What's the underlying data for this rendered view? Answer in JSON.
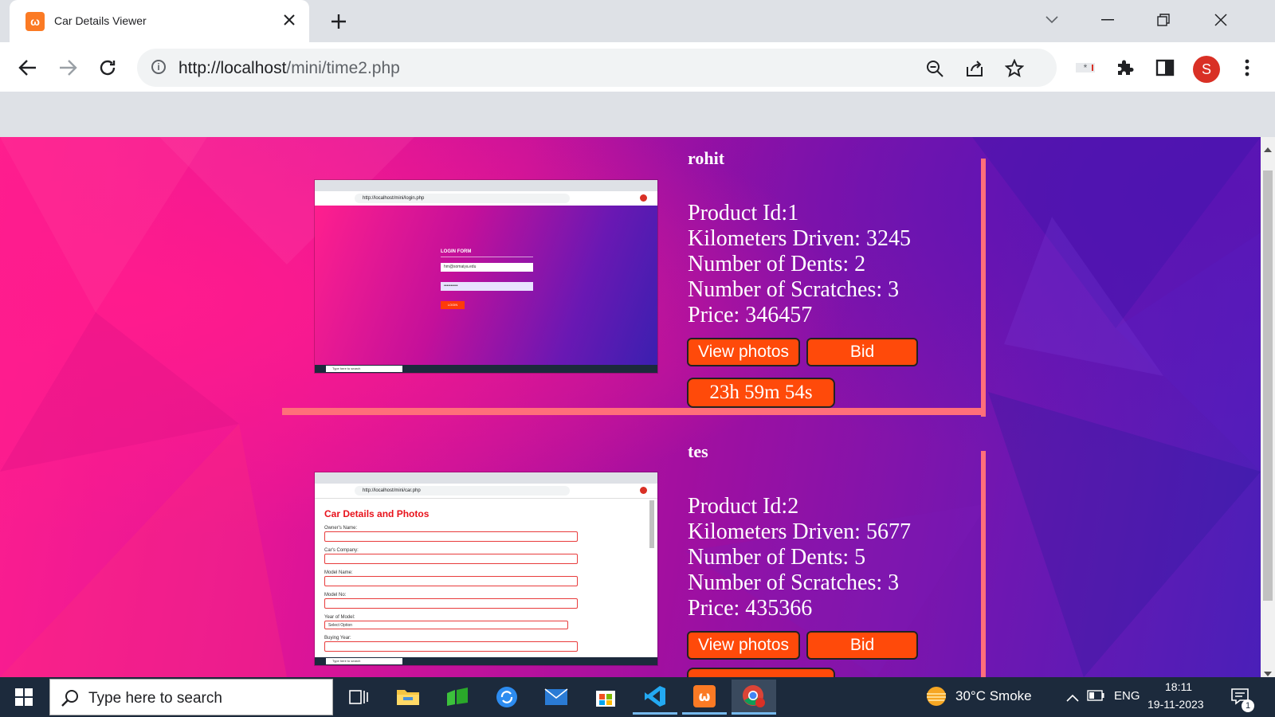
{
  "browser": {
    "tab_title": "Car Details Viewer",
    "url_host": "http://localhost",
    "url_path": "/mini/time2.php",
    "profile_initial": "S",
    "extension_badge": "*"
  },
  "listings": [
    {
      "owner": "rohit",
      "product_id": "Product Id:1",
      "kilometers": "Kilometers Driven: 3245",
      "dents": "Number of Dents: 2",
      "scratches": "Number of Scratches: 3",
      "price": "Price: 346457",
      "view_label": "View photos",
      "bid_label": "Bid",
      "timer": "23h 59m 54s",
      "thumb": {
        "kind": "login",
        "url": "http://localhost/mini/login.php",
        "form_title": "LOGIN FORM",
        "email_value": "hm@somaiya.edu",
        "password_value": "••••••••••",
        "button": "LOGIN",
        "search_hint": "Type here to search"
      }
    },
    {
      "owner": "tes",
      "product_id": "Product Id:2",
      "kilometers": "Kilometers Driven: 5677",
      "dents": "Number of Dents: 5",
      "scratches": "Number of Scratches: 3",
      "price": "Price: 435366",
      "view_label": "View photos",
      "bid_label": "Bid",
      "thumb": {
        "kind": "form",
        "url": "http://localhost/mini/car.php",
        "heading": "Car Details and Photos",
        "fields": [
          "Owner's Name:",
          "Car's Company:",
          "Model Name:",
          "Model No:",
          "Year of Model:",
          "Buying Year:"
        ],
        "select_placeholder": "Select Option",
        "search_hint": "Type here to search"
      }
    }
  ],
  "taskbar": {
    "search_placeholder": "Type here to search",
    "weather": "30°C  Smoke",
    "language": "ENG",
    "time": "18:11",
    "date": "19-11-2023",
    "notification_count": "1"
  }
}
